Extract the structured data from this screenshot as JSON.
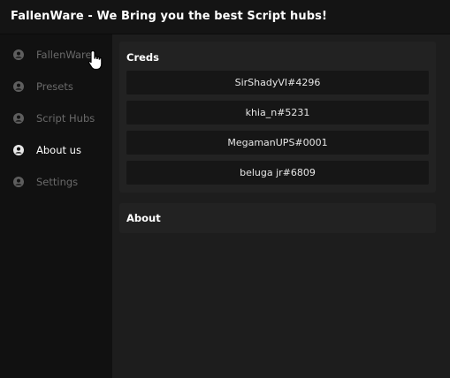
{
  "window": {
    "title": "FallenWare - We Bring you the best Script hubs!"
  },
  "sidebar": {
    "items": [
      {
        "label": "FallenWare",
        "icon": "user-circle-icon",
        "active": false
      },
      {
        "label": "Presets",
        "icon": "user-circle-icon",
        "active": false
      },
      {
        "label": "Script Hubs",
        "icon": "user-circle-icon",
        "active": false
      },
      {
        "label": "About us",
        "icon": "user-circle-icon",
        "active": true
      },
      {
        "label": "Settings",
        "icon": "user-circle-icon",
        "active": false
      }
    ]
  },
  "main": {
    "creds": {
      "title": "Creds",
      "names": [
        "SirShadyVI#4296",
        "khia_n#5231",
        "MegamanUPS#0001",
        "beluga jr#6809"
      ]
    },
    "about": {
      "title": "About"
    }
  },
  "colors": {
    "titlebar": "#141414",
    "sidebar": "#111111",
    "main": "#1d1d1d",
    "section": "#222222",
    "row": "#161616",
    "active_text": "#ffffff",
    "inactive_text": "#6a6a6a"
  }
}
